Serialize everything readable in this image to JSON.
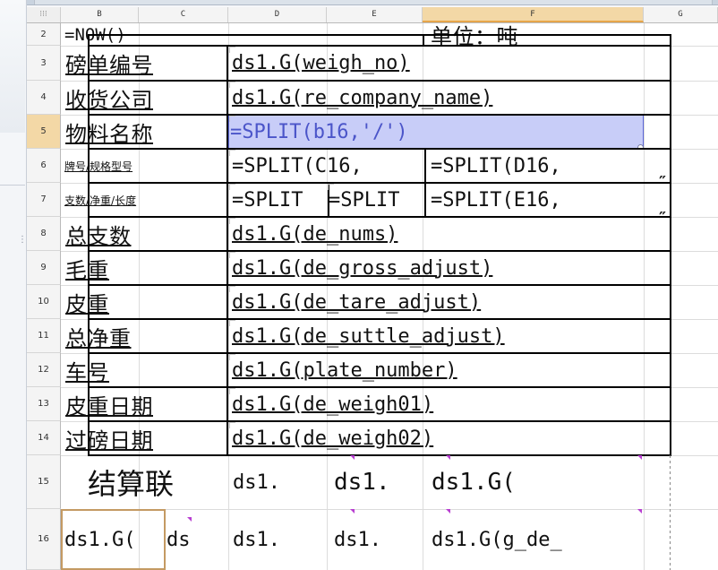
{
  "sheet": {
    "columns": {
      "corner": "⁝⁝⁝",
      "b": "B",
      "c": "C",
      "d": "D",
      "e": "E",
      "f": "F",
      "g": "G"
    },
    "rows": [
      "2",
      "3",
      "4",
      "5",
      "6",
      "7",
      "8",
      "9",
      "10",
      "11",
      "12",
      "13",
      "14",
      "15",
      "16"
    ],
    "cells": {
      "r2_bc": "=NOW()",
      "r2_f": "单位：吨",
      "r3_bc": "磅单编号",
      "r3_def": "ds1.G(weigh_no)",
      "r4_bc": "收货公司",
      "r4_def": "ds1.G(re_company_name)",
      "r5_bc": "物料名称",
      "r5_def": "=SPLIT(b16,'/')",
      "r6_bc": "牌号/规格型号",
      "r6_d": "=SPLIT(C16,",
      "r6_f": "=SPLIT(D16,",
      "r7_bc": "支数/净重/长度",
      "r7_d": "=SPLIT",
      "r7_e": "=SPLIT",
      "r7_f": "=SPLIT(E16,",
      "r8_bc": "总支数",
      "r8_def": "ds1.G(de_nums)",
      "r9_bc": "毛重",
      "r9_def": "ds1.G(de_gross_adjust)",
      "r10_bc": "皮重",
      "r10_def": "ds1.G(de_tare_adjust)",
      "r11_bc": "总净重",
      "r11_def": "ds1.G(de_suttle_adjust)",
      "r12_bc": "车号",
      "r12_def": "ds1.G(plate_number)",
      "r13_bc": "皮重日期",
      "r13_def": "ds1.G(de_weigh01)",
      "r14_bc": "过磅日期",
      "r14_def": "ds1.G(de_weigh02)",
      "r15_bc": "结算联",
      "r15_d": "ds1.",
      "r15_e": "ds1.",
      "r15_f": "ds1.G(",
      "r16_b": "ds1.G(",
      "r16_c": "ds",
      "r16_d": "ds1.",
      "r16_e": "ds1.",
      "r16_f": "ds1.G(g_de_"
    }
  },
  "colors": {
    "selection_fill": "#c8cdf8",
    "selection_text": "#4b55c9",
    "header_active": "#f3d8a6",
    "marker": "#b83ed1"
  },
  "icons": {
    "corner": "grid-select-icon",
    "grip": "drag-grip-icon",
    "marker": "formula-marker-icon",
    "fill": "fill-handle-icon"
  }
}
